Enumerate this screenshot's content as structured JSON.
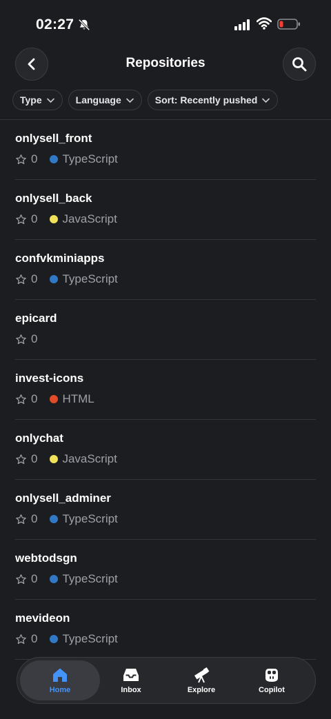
{
  "status": {
    "time": "02:27"
  },
  "header": {
    "title": "Repositories"
  },
  "filters": [
    {
      "label": "Type"
    },
    {
      "label": "Language"
    },
    {
      "label": "Sort: Recently pushed"
    }
  ],
  "repos": [
    {
      "name": "onlysell_front",
      "stars": "0",
      "language": "TypeScript",
      "color": "#3178c6"
    },
    {
      "name": "onlysell_back",
      "stars": "0",
      "language": "JavaScript",
      "color": "#f1e05a"
    },
    {
      "name": "confvkminiapps",
      "stars": "0",
      "language": "TypeScript",
      "color": "#3178c6"
    },
    {
      "name": "epicard",
      "stars": "0",
      "language": "",
      "color": ""
    },
    {
      "name": "invest-icons",
      "stars": "0",
      "language": "HTML",
      "color": "#e34c26"
    },
    {
      "name": "onlychat",
      "stars": "0",
      "language": "JavaScript",
      "color": "#f1e05a"
    },
    {
      "name": "onlysell_adminer",
      "stars": "0",
      "language": "TypeScript",
      "color": "#3178c6"
    },
    {
      "name": "webtodsgn",
      "stars": "0",
      "language": "TypeScript",
      "color": "#3178c6"
    },
    {
      "name": "mevideon",
      "stars": "0",
      "language": "TypeScript",
      "color": "#3178c6"
    }
  ],
  "tabs": {
    "home": "Home",
    "inbox": "Inbox",
    "explore": "Explore",
    "copilot": "Copilot"
  },
  "colors": {
    "accent": "#4493f8",
    "background": "#1c1d20"
  }
}
